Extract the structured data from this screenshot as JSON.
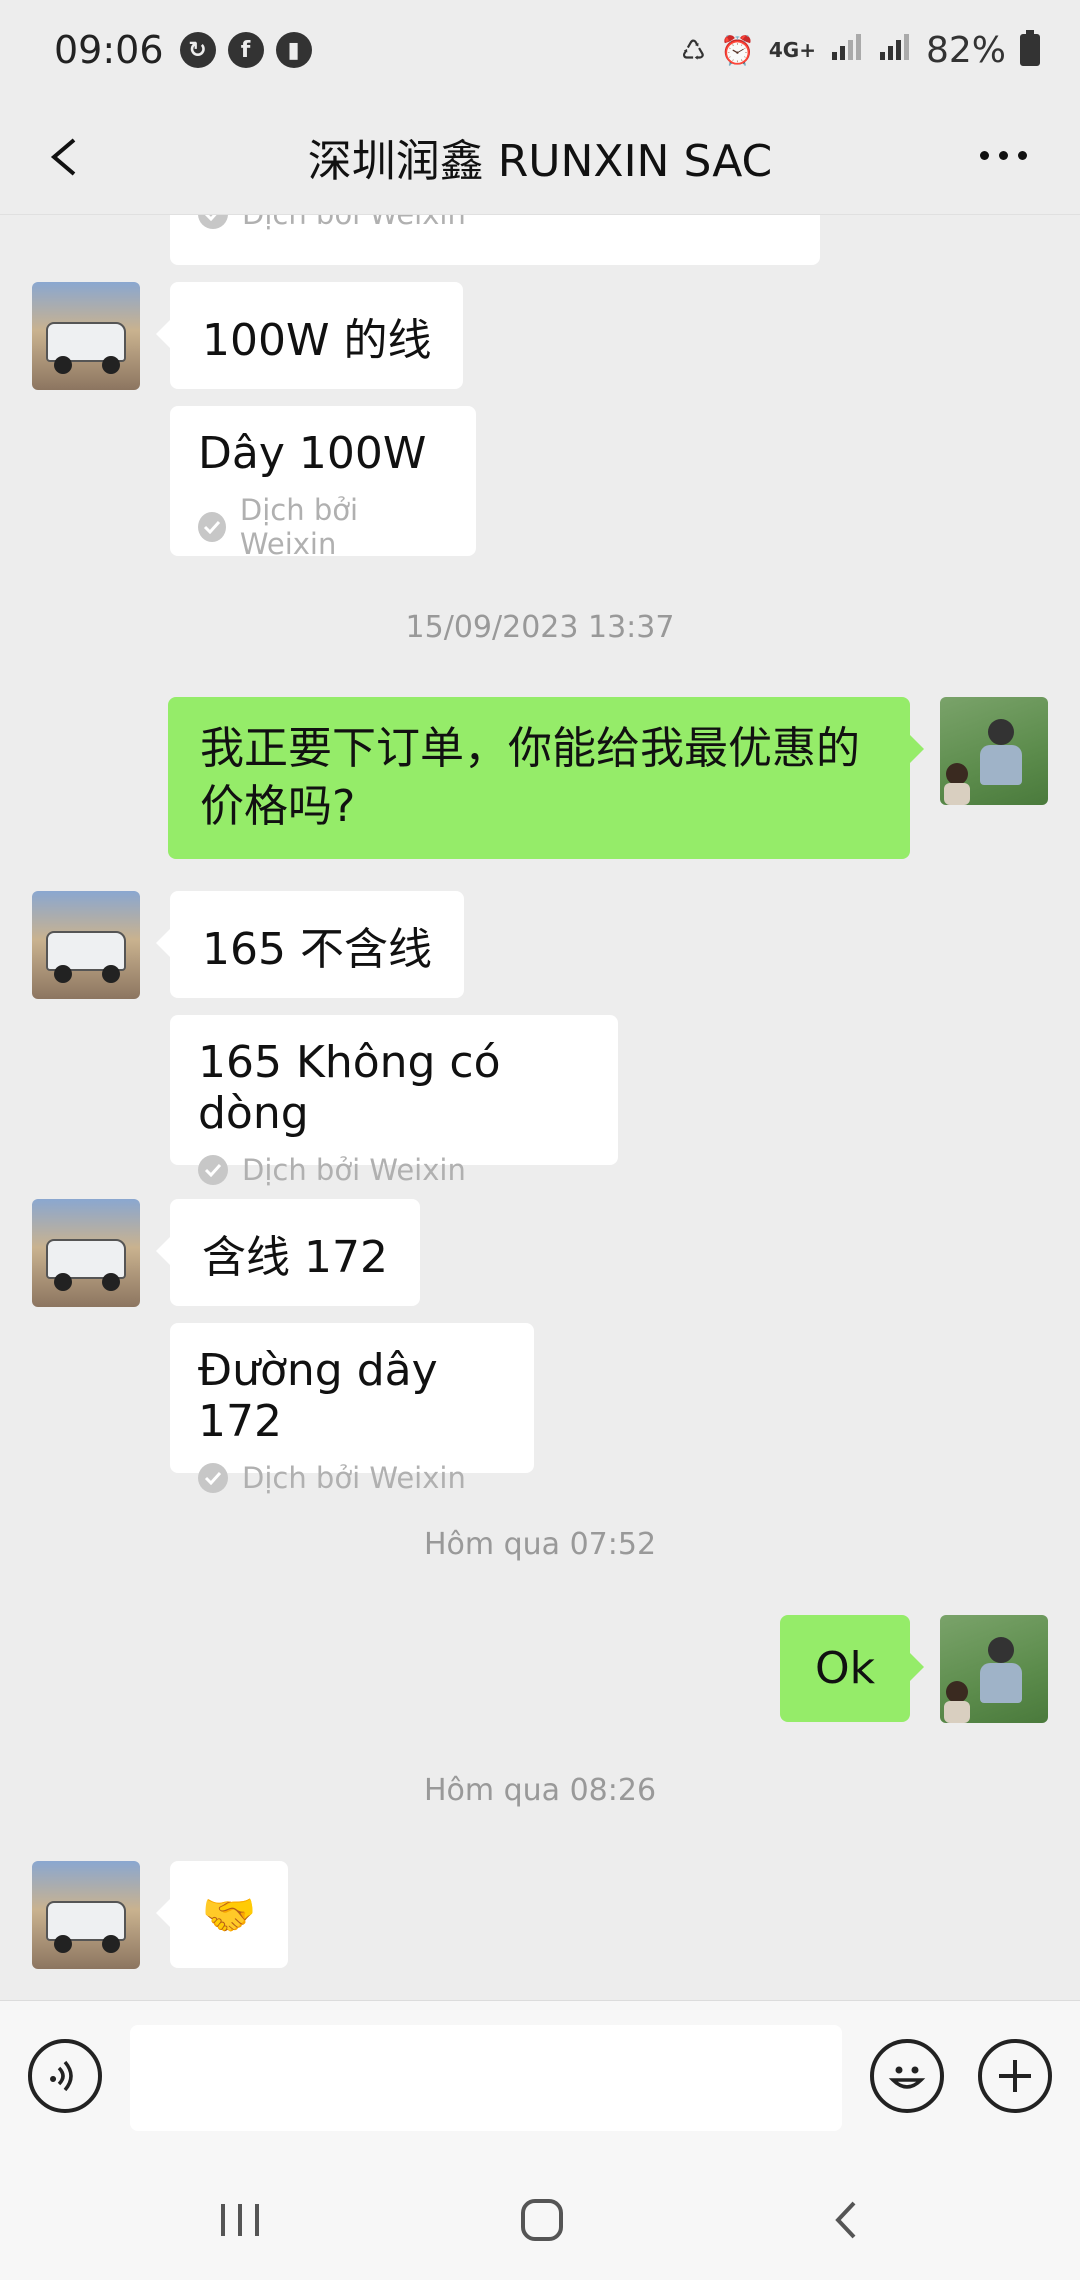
{
  "status_bar": {
    "time": "09:06",
    "battery": "82%",
    "network": "4G+",
    "icons": [
      "sync-icon",
      "facebook-icon",
      "sound-icon",
      "battery-saver-icon",
      "alarm-icon",
      "signal-icon",
      "signal-icon",
      "battery-icon"
    ]
  },
  "header": {
    "title": "深圳润鑫 RUNXIN SAC"
  },
  "messages": {
    "partial_label": "Dịch bởi Weixin",
    "m1_text": "100W 的线",
    "m1_translation": "Dây 100W",
    "translation_label": "Dịch bởi Weixin",
    "ts1": "15/09/2023 13:37",
    "m2_text": "我正要下订单，你能给我最优惠的价格吗?",
    "m3_text": "165 不含线",
    "m3_translation": "165 Không có dòng",
    "m4_text": "含线 172",
    "m4_translation": "Đường dây 172",
    "ts2": "Hôm qua 07:52",
    "m5_text": "Ok",
    "ts3": "Hôm qua 08:26",
    "m6_text": "🤝"
  },
  "input": {
    "value": "",
    "placeholder": ""
  },
  "colors": {
    "background": "#ededed",
    "sent_bubble": "#95ec69",
    "received_bubble": "#ffffff",
    "meta_text": "#999999"
  }
}
